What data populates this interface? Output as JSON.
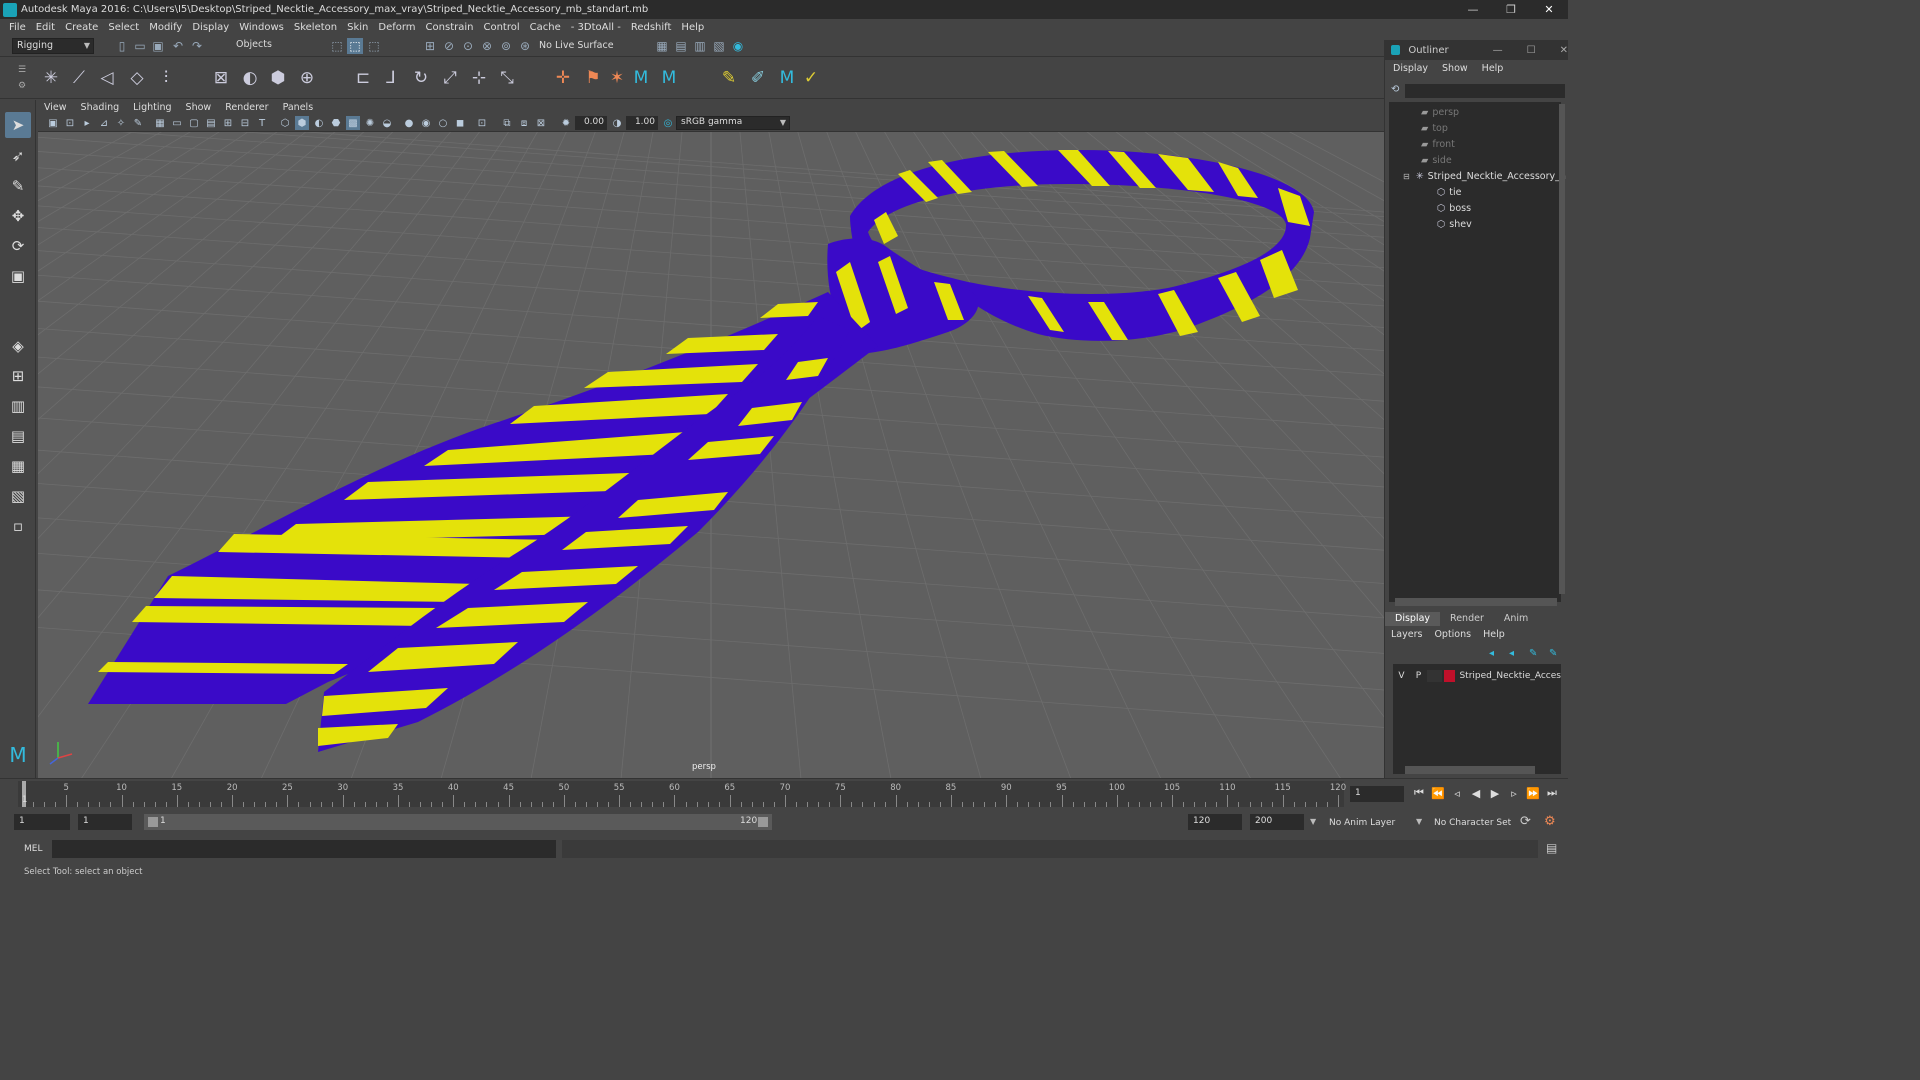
{
  "window": {
    "title": "Autodesk Maya 2016: C:\\Users\\I5\\Desktop\\Striped_Necktie_Accessory_max_vray\\Striped_Necktie_Accessory_mb_standart.mb",
    "minimize": "—",
    "restore": "❐",
    "close": "✕"
  },
  "menu": [
    "File",
    "Edit",
    "Create",
    "Select",
    "Modify",
    "Display",
    "Windows",
    "Skeleton",
    "Skin",
    "Deform",
    "Constrain",
    "Control",
    "Cache",
    "- 3DtoAll -",
    "Redshift",
    "Help"
  ],
  "status_line": {
    "mode": "Rigging",
    "selection_mask": "Objects",
    "live_surface": "No Live Surface"
  },
  "panel_menu": [
    "View",
    "Shading",
    "Lighting",
    "Show",
    "Renderer",
    "Panels"
  ],
  "panel_toolbar": {
    "exposure": "0.00",
    "gamma": "1.00",
    "color_space": "sRGB gamma"
  },
  "viewport": {
    "camera_label": "persp",
    "colors": {
      "purple": "#3a0ac8",
      "yellow": "#e4e20a",
      "grid": "#6d6d6d"
    }
  },
  "outliner": {
    "title": "Outliner",
    "menu": [
      "Display",
      "Show",
      "Help"
    ],
    "items": [
      {
        "label": "persp",
        "dim": true
      },
      {
        "label": "top",
        "dim": true
      },
      {
        "label": "front",
        "dim": true
      },
      {
        "label": "side",
        "dim": true
      },
      {
        "label": "Striped_Necktie_Accessory_n",
        "dim": false
      },
      {
        "label": "tie",
        "dim": false
      },
      {
        "label": "boss",
        "dim": false
      },
      {
        "label": "shev",
        "dim": false
      }
    ]
  },
  "layer_editor": {
    "tabs": [
      "Display",
      "Render",
      "Anim"
    ],
    "menu": [
      "Layers",
      "Options",
      "Help"
    ],
    "layer": {
      "v": "V",
      "p": "P",
      "name": "Striped_Necktie_Acces",
      "color": "#c0102a"
    }
  },
  "timeline": {
    "ticks": [
      "5",
      "10",
      "15",
      "20",
      "25",
      "30",
      "35",
      "40",
      "45",
      "50",
      "55",
      "60",
      "65",
      "70",
      "75",
      "80",
      "85",
      "90",
      "95",
      "100",
      "105",
      "110",
      "115",
      "120"
    ],
    "start_label": "1",
    "current_frame": "1"
  },
  "range": {
    "start": "1",
    "playback_start": "1",
    "slider_start": "1",
    "slider_end": "120",
    "playback_end": "120",
    "end": "200",
    "anim_layer": "No Anim Layer",
    "character_set": "No Character Set"
  },
  "command_line": {
    "language": "MEL"
  },
  "help_line": "Select Tool: select an object"
}
